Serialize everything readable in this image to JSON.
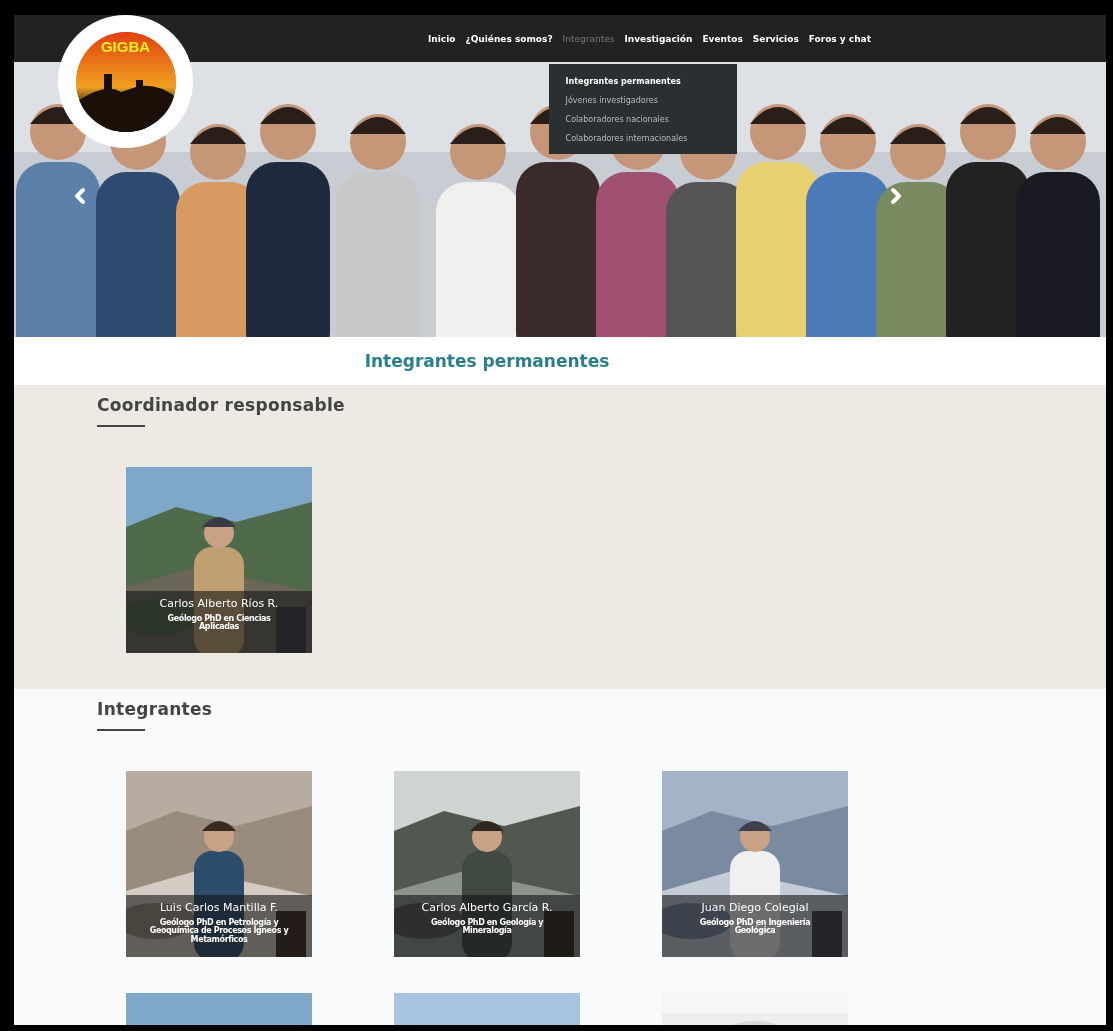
{
  "nav": {
    "items": [
      {
        "label": "Inicio",
        "selected": false
      },
      {
        "label": "¿Quiénes somos?",
        "selected": false
      },
      {
        "label": "Integrantes",
        "selected": true
      },
      {
        "label": "Investigación",
        "selected": false
      },
      {
        "label": "Eventos",
        "selected": false
      },
      {
        "label": "Servicios",
        "selected": false
      },
      {
        "label": "Foros y chat",
        "selected": false
      }
    ],
    "dropdown": [
      {
        "label": "Integrantes permanentes",
        "selected": true
      },
      {
        "label": "Jóvenes investigadores",
        "selected": false
      },
      {
        "label": "Colaboradores nacionales",
        "selected": false
      },
      {
        "label": "Colaboradores internacionales",
        "selected": false
      }
    ]
  },
  "logo": {
    "text": "GIGBA"
  },
  "hero": {
    "kind": "picture"
  },
  "page_title": "Integrantes permanentes",
  "sections": [
    {
      "title": "Coordinador responsable",
      "members": [
        {
          "kind": "member",
          "name": "Carlos Alberto Ríos R.",
          "role": "Geólogo PhD en Ciencias Aplicadas"
        }
      ]
    },
    {
      "title": "Integrantes",
      "members": [
        {
          "kind": "member",
          "name": "Luis Carlos Mantilla F.",
          "role": "Geólogo PhD en Petrología y Geoquímica de Procesos Ígneos y Metamórficos"
        },
        {
          "kind": "member",
          "name": "Carlos Alberto García R.",
          "role": "Geólogo PhD en Geología y Mineralogía"
        },
        {
          "kind": "member",
          "name": "Juan Diego Colegial",
          "role": "Geólogo PhD en Ingeniería Geológica"
        },
        {
          "kind": "picture"
        },
        {
          "kind": "picture"
        },
        {
          "kind": "blank"
        }
      ]
    }
  ]
}
